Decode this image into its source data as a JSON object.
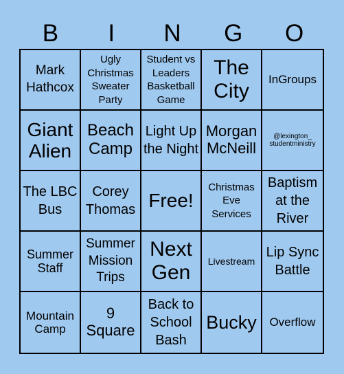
{
  "header": {
    "letters": [
      "B",
      "I",
      "N",
      "G",
      "O"
    ]
  },
  "card": {
    "background_color": "#a0c9ef",
    "cells": [
      "Mark Hathcox",
      "Ugly Christmas Sweater Party",
      "Student vs Leaders Basketball Game",
      "The City",
      "InGroups",
      "Giant Alien",
      "Beach Camp",
      "Light Up the Night",
      "Morgan McNeill",
      "@lexington_ studentministry",
      "The LBC Bus",
      "Corey Thomas",
      "Free!",
      "Christmas Eve Services",
      "Baptism at the River",
      "Summer Staff",
      "Summer Mission Trips",
      "Next Gen",
      "Livestream",
      "Lip Sync Battle",
      "Mountain Camp",
      "9 Square",
      "Back to School Bash",
      "Bucky",
      "Overflow"
    ]
  }
}
